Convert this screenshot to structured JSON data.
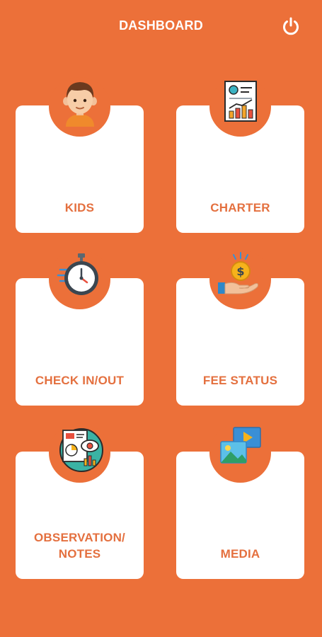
{
  "header": {
    "title": "DASHBOARD",
    "power_icon": "power-icon"
  },
  "tiles": [
    {
      "label": "KIDS",
      "icon": "child-face-icon"
    },
    {
      "label": "CHARTER",
      "icon": "charter-document-icon"
    },
    {
      "label": "CHECK IN/OUT",
      "icon": "stopwatch-icon"
    },
    {
      "label": "FEE STATUS",
      "icon": "coin-hand-icon"
    },
    {
      "label": "OBSERVATION/\nNOTES",
      "icon": "observation-report-icon"
    },
    {
      "label": "MEDIA",
      "icon": "media-gallery-icon"
    }
  ],
  "colors": {
    "background": "#ec7039",
    "tile": "#ffffff",
    "label": "#e4703f"
  }
}
